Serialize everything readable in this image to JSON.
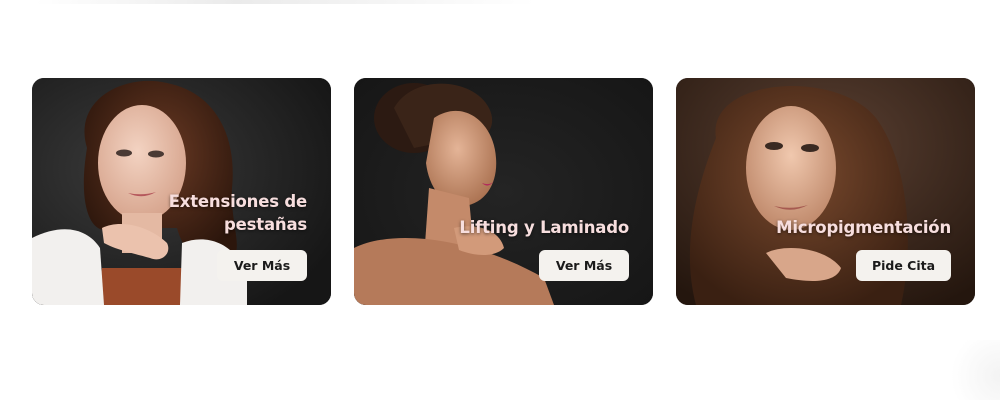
{
  "cards": [
    {
      "title": "Extensiones de pestañas",
      "button_label": "Ver Más",
      "photo": "woman-portrait-white-blazer"
    },
    {
      "title": "Lifting y Laminado",
      "button_label": "Ver Más",
      "photo": "woman-profile-bun-dark-background"
    },
    {
      "title": "Micropigmentación",
      "button_label": "Pide Cita",
      "photo": "woman-portrait-wavy-hair-brown-background"
    }
  ],
  "colors": {
    "card_title": "#f7dede",
    "button_bg": "#f4f2ee",
    "button_text": "#1b1b1b",
    "card_bg": "#1e1e1e"
  }
}
